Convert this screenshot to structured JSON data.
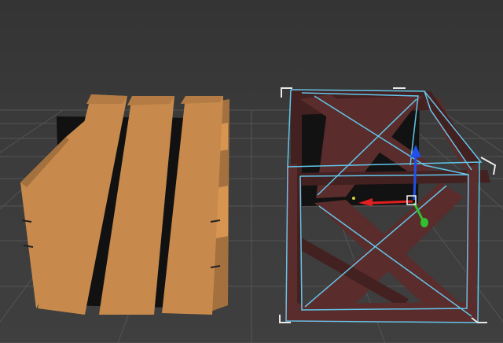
{
  "viewport": {
    "view": "perspective",
    "background_color": "#3a3a3a",
    "grid_color": "#545454"
  },
  "objects": [
    {
      "name": "slatted-crate",
      "color": "#c88a4c",
      "selected": false
    },
    {
      "name": "frame-crate",
      "color": "#5a2c2c",
      "selected": true,
      "selection_color": "#62c6ea"
    }
  ],
  "transform_gizmo": {
    "mode": "move",
    "axes": [
      {
        "axis": "x",
        "color": "#e02020"
      },
      {
        "axis": "y",
        "color": "#30c030"
      },
      {
        "axis": "z",
        "color": "#2050e8"
      }
    ]
  }
}
